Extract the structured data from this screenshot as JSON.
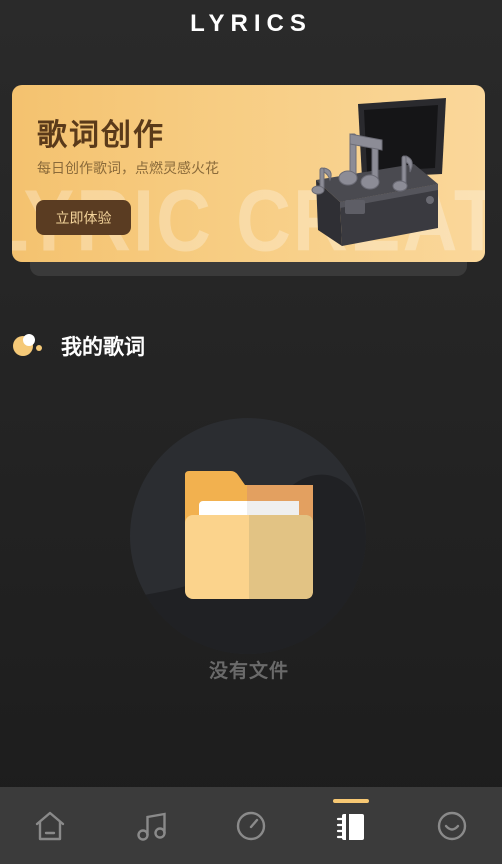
{
  "app": {
    "title": "LYRICS"
  },
  "banner": {
    "title": "歌词创作",
    "subtitle": "每日创作歌词，点燃灵感火花",
    "watermark": "LYRIC CREATION",
    "button_label": "立即体验"
  },
  "section": {
    "title": "我的歌词"
  },
  "empty_state": {
    "text": "没有文件"
  },
  "tabbar": {
    "active_index": 3,
    "tabs": [
      {
        "icon": "home-icon"
      },
      {
        "icon": "music-note-icon"
      },
      {
        "icon": "gauge-icon"
      },
      {
        "icon": "notebook-icon"
      },
      {
        "icon": "smiley-icon"
      }
    ]
  },
  "colors": {
    "accent": "#f7c873",
    "banner_button": "#5a3c22",
    "background": "#242424",
    "tabbar": "#3b3b3b"
  }
}
